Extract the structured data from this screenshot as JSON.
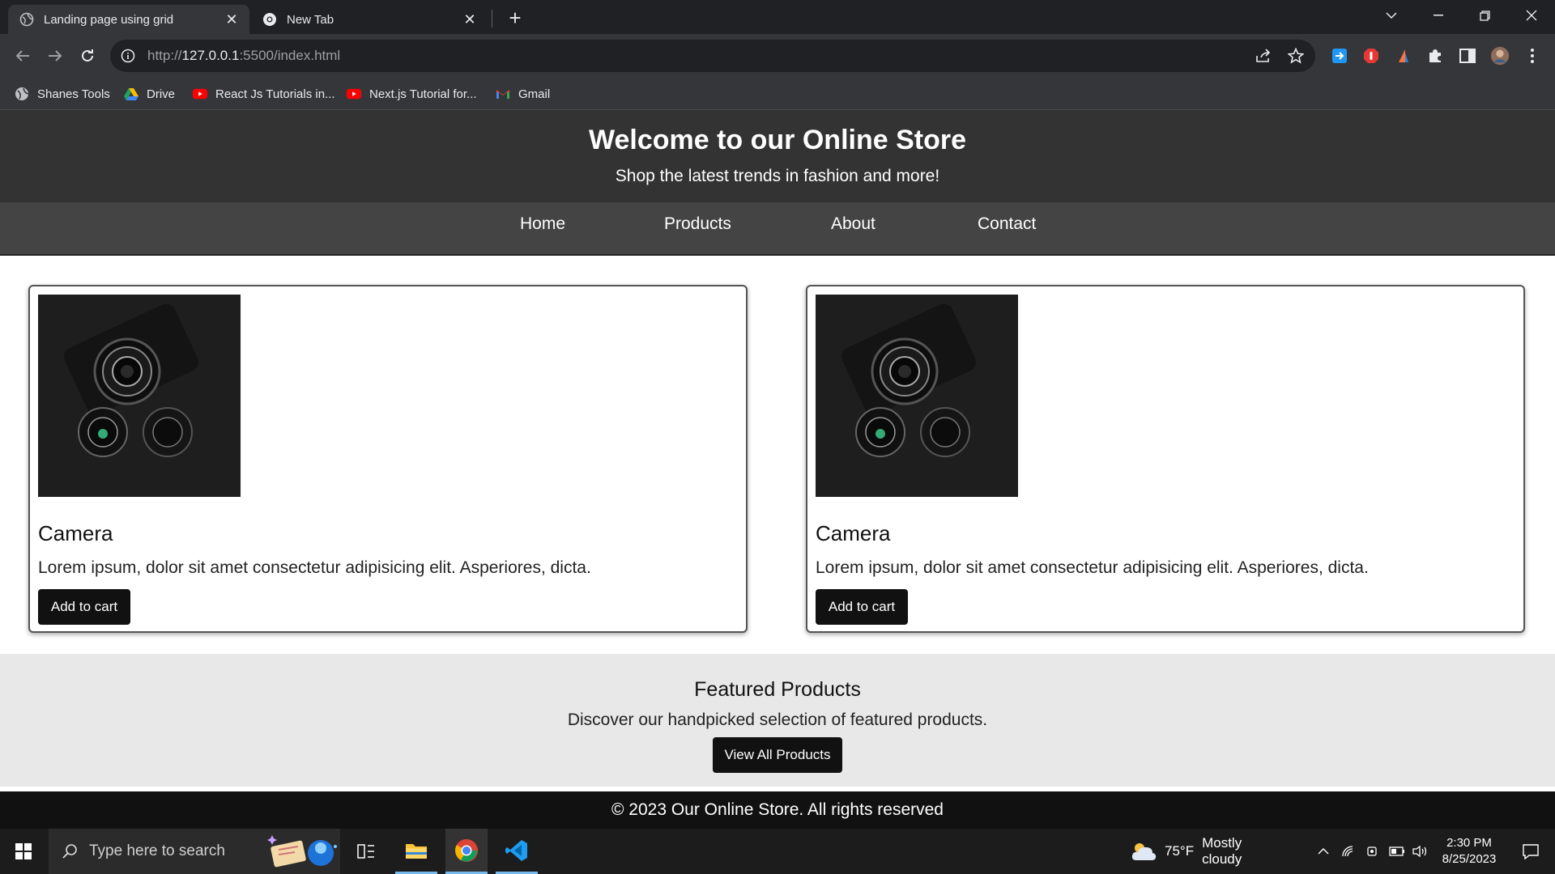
{
  "browser": {
    "tabs": [
      {
        "title": "Landing page using grid",
        "active": true
      },
      {
        "title": "New Tab",
        "active": false
      }
    ],
    "url_prefix": "http://",
    "url_host": "127.0.0.1",
    "url_rest": ":5500/index.html",
    "bookmarks": [
      {
        "label": "Shanes Tools",
        "icon": "globe-icon"
      },
      {
        "label": "Drive",
        "icon": "google-drive-icon"
      },
      {
        "label": "React Js Tutorials in...",
        "icon": "youtube-icon"
      },
      {
        "label": "Next.js Tutorial for...",
        "icon": "youtube-icon"
      },
      {
        "label": "Gmail",
        "icon": "gmail-icon"
      }
    ]
  },
  "site": {
    "header": {
      "title": "Welcome to our Online Store",
      "subtitle": "Shop the latest trends in fashion and more!"
    },
    "nav": [
      "Home",
      "Products",
      "About",
      "Contact"
    ],
    "products": [
      {
        "name": "Camera",
        "description": "Lorem ipsum, dolor sit amet consectetur adipisicing elit. Asperiores, dicta.",
        "button": "Add to cart"
      },
      {
        "name": "Camera",
        "description": "Lorem ipsum, dolor sit amet consectetur adipisicing elit. Asperiores, dicta.",
        "button": "Add to cart"
      }
    ],
    "featured": {
      "title": "Featured Products",
      "text": "Discover our handpicked selection of featured products.",
      "button": "View All Products"
    },
    "footer": "© 2023 Our Online Store. All rights reserved"
  },
  "taskbar": {
    "search_placeholder": "Type here to search",
    "weather_temp": "75°F",
    "weather_text": "Mostly cloudy",
    "time": "2:30 PM",
    "date": "8/25/2023"
  },
  "colors": {
    "header_bg": "#333333",
    "nav_bg": "#444444",
    "button_bg": "#111111",
    "featured_bg": "#e8e8e8",
    "footer_bg": "#111111"
  }
}
